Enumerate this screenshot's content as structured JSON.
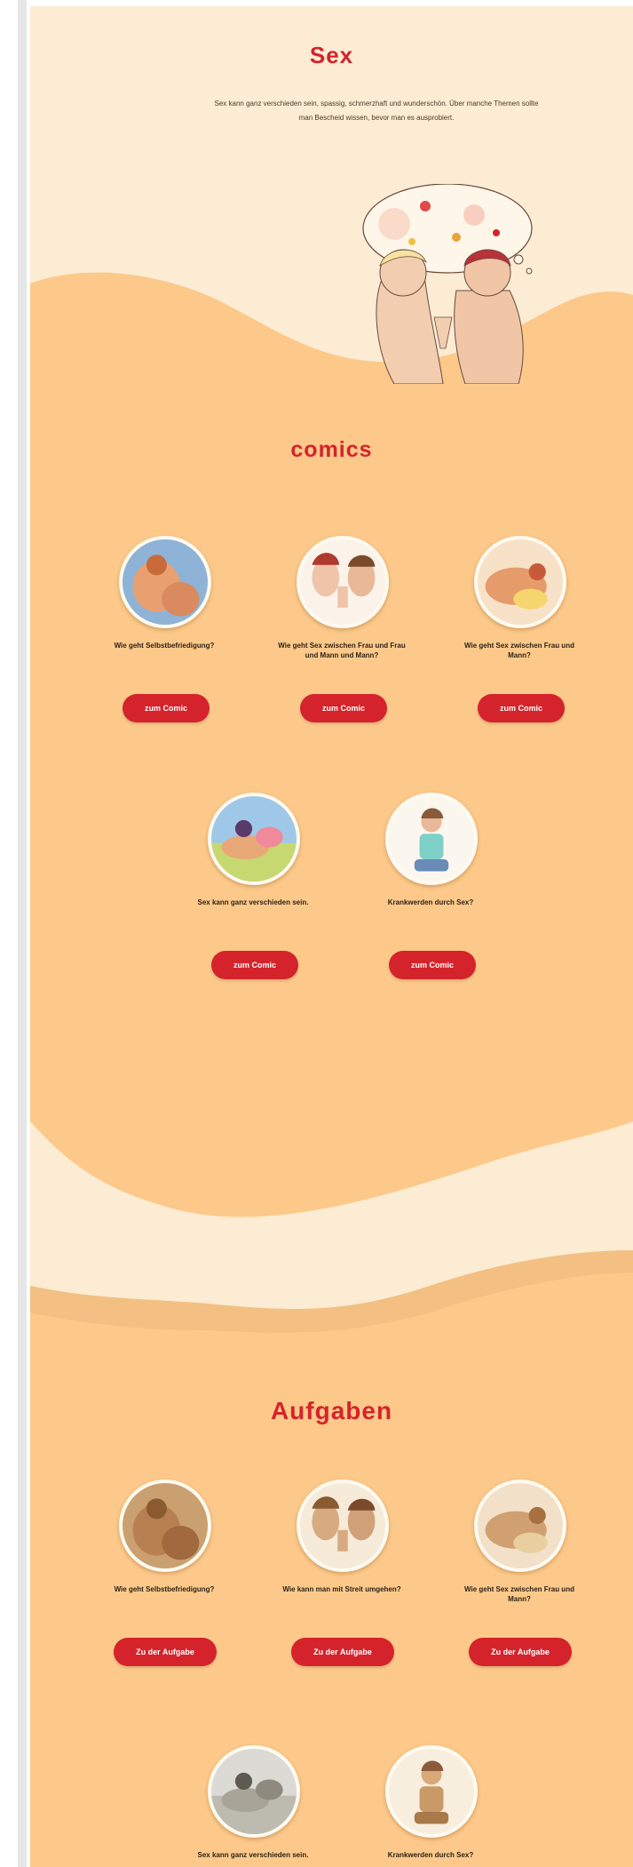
{
  "hero": {
    "title": "Sex",
    "intro": "Sex kann ganz verschieden sein, spassig, schmerzhaft und wunderschön. Über manche Themen sollte man Bescheid wissen, bevor man es ausprobiert."
  },
  "comics": {
    "title": "comics",
    "items": [
      {
        "label": "Wie geht Selbstbefriedigung?",
        "button": "zum Comic",
        "icon": "couple-relaxing-illustration"
      },
      {
        "label": "Wie geht Sex zwischen Frau und Frau und Mann und Mann?",
        "button": "zum Comic",
        "icon": "two-faces-hands-together-illustration"
      },
      {
        "label": "Wie geht Sex zwischen Frau und Mann?",
        "button": "zum Comic",
        "icon": "couple-in-bed-illustration"
      },
      {
        "label": "Sex kann ganz verschieden sein.",
        "button": "zum Comic",
        "icon": "couple-lying-illustration"
      },
      {
        "label": "Krankwerden durch Sex?",
        "button": "zum Comic",
        "icon": "woman-sitting-illustration"
      }
    ]
  },
  "tasks": {
    "title": "Aufgaben",
    "items": [
      {
        "label": "Wie geht Selbstbefriedigung?",
        "button": "Zu der Aufgabe",
        "icon": "couple-relaxing-sepia-illustration"
      },
      {
        "label": "Wie kann man mit Streit umgehen?",
        "button": "Zu der Aufgabe",
        "icon": "two-faces-sepia-illustration"
      },
      {
        "label": "Wie geht Sex zwischen Frau und Mann?",
        "button": "Zu der Aufgabe",
        "icon": "couple-in-bed-sepia-illustration"
      },
      {
        "label": "Sex kann ganz verschieden sein.",
        "button": "",
        "icon": "couple-lying-grey-illustration"
      },
      {
        "label": "Krankwerden durch Sex?",
        "button": "",
        "icon": "woman-sitting-sepia-illustration"
      }
    ]
  },
  "colors": {
    "accent": "#d5232b",
    "cream": "#fbecd3",
    "peach": "#fcc98a"
  }
}
